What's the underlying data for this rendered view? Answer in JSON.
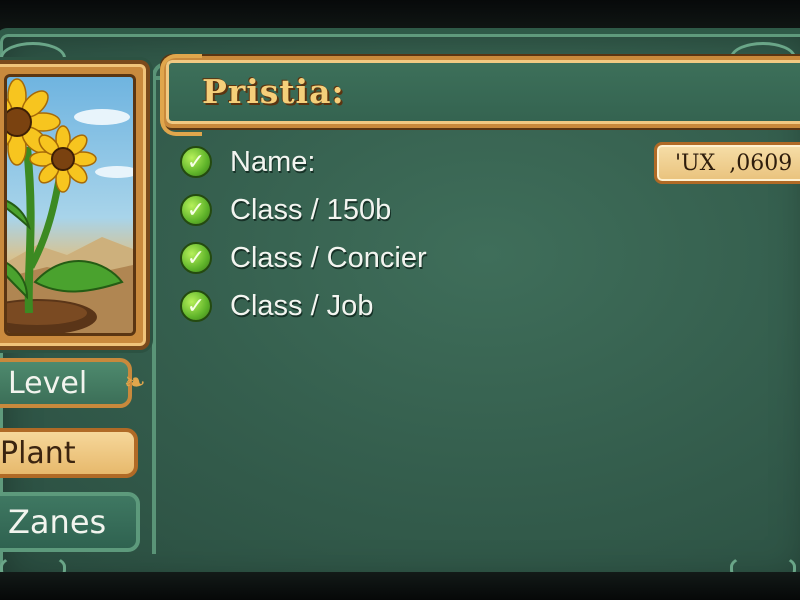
{
  "title": "Pristia:",
  "value_box": "'UX  ,0609",
  "checklist": [
    {
      "label": "Name:",
      "icon": "check-icon"
    },
    {
      "label": "Class / 150b",
      "icon": "check-icon"
    },
    {
      "label": "Class / Concier",
      "icon": "check-icon"
    },
    {
      "label": "Class / Job",
      "icon": "check-icon"
    }
  ],
  "side_tabs": {
    "level": "Level",
    "plant": "Plant",
    "zanes": "Zanes"
  },
  "portrait": {
    "subject": "sunflower-plant",
    "icon": "sunflower-icon"
  },
  "colors": {
    "board_green": "#355f4e",
    "frame_gold": "#c9893b",
    "title_gold": "#f5cf7a",
    "check_green": "#5fb42a",
    "parchment": "#f0cf8e"
  }
}
